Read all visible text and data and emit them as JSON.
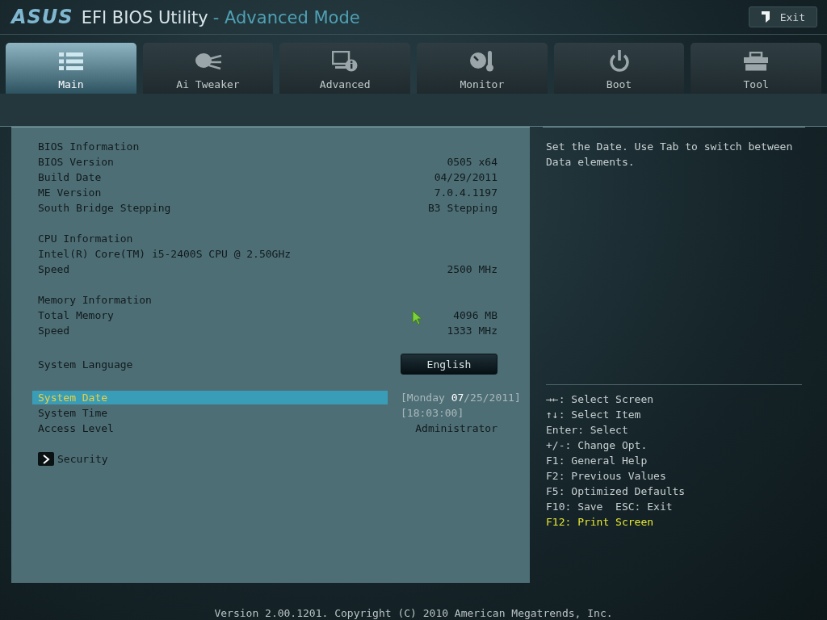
{
  "header": {
    "logo": "ASUS",
    "title": "EFI BIOS Utility",
    "mode": "- Advanced Mode",
    "exit_button": "Exit"
  },
  "tabs": [
    {
      "label": "Main",
      "selected": true
    },
    {
      "label": "Ai Tweaker",
      "selected": false
    },
    {
      "label": "Advanced",
      "selected": false
    },
    {
      "label": "Monitor",
      "selected": false
    },
    {
      "label": "Boot",
      "selected": false
    },
    {
      "label": "Tool",
      "selected": false
    }
  ],
  "main_panel": {
    "sections": [
      {
        "items": [
          {
            "kind": "heading",
            "label": "BIOS Information",
            "selected": false
          },
          {
            "kind": "info",
            "label": "BIOS Version",
            "value": "0505 x64",
            "selected": false
          },
          {
            "kind": "info",
            "label": "Build Date",
            "value": "04/29/2011",
            "selected": false
          },
          {
            "kind": "info",
            "label": "ME Version",
            "value": "7.0.4.1197",
            "selected": false
          },
          {
            "kind": "info",
            "label": "South Bridge Stepping",
            "value": "B3 Stepping",
            "selected": false
          }
        ]
      },
      {
        "items": [
          {
            "kind": "heading",
            "label": "CPU Information",
            "selected": false
          },
          {
            "kind": "heading",
            "label": "Intel(R) Core(TM) i5-2400S CPU @ 2.50GHz",
            "selected": false
          },
          {
            "kind": "info",
            "label": "Speed",
            "value": "2500 MHz",
            "selected": false
          }
        ]
      },
      {
        "items": [
          {
            "kind": "heading",
            "label": "Memory Information",
            "selected": false
          },
          {
            "kind": "info",
            "label": "Total Memory",
            "value": "4096 MB",
            "selected": false
          },
          {
            "kind": "info",
            "label": "Speed",
            "value": "1333 MHz",
            "selected": false
          }
        ]
      },
      {
        "items": [
          {
            "kind": "select",
            "label": "System Language",
            "value": "English",
            "selected": false
          }
        ]
      },
      {
        "items": [
          {
            "kind": "field",
            "label": "System Date",
            "value": "[Monday **07**/25/2011]",
            "selected": true
          },
          {
            "kind": "field",
            "label": "System Time",
            "value": "[18:03:00]",
            "selected": false
          },
          {
            "kind": "info",
            "label": "Access Level",
            "value": "Administrator",
            "selected": false
          }
        ]
      },
      {
        "items": [
          {
            "kind": "submenu",
            "label": "Security",
            "selected": false
          }
        ]
      }
    ]
  },
  "help_text": "Set the Date. Use Tab to switch between Data elements.",
  "key_help": [
    {
      "text": "→←: Select Screen",
      "highlight": false
    },
    {
      "text": "↑↓: Select Item",
      "highlight": false
    },
    {
      "text": "Enter: Select",
      "highlight": false
    },
    {
      "text": "+/-: Change Opt.",
      "highlight": false
    },
    {
      "text": "F1: General Help",
      "highlight": false
    },
    {
      "text": "F2: Previous Values",
      "highlight": false
    },
    {
      "text": "F5: Optimized Defaults",
      "highlight": false
    },
    {
      "text": "F10: Save  ESC: Exit",
      "highlight": false
    },
    {
      "text": "F12: Print Screen",
      "highlight": true
    }
  ],
  "footer": "Version 2.00.1201. Copyright (C) 2010 American Megatrends, Inc."
}
